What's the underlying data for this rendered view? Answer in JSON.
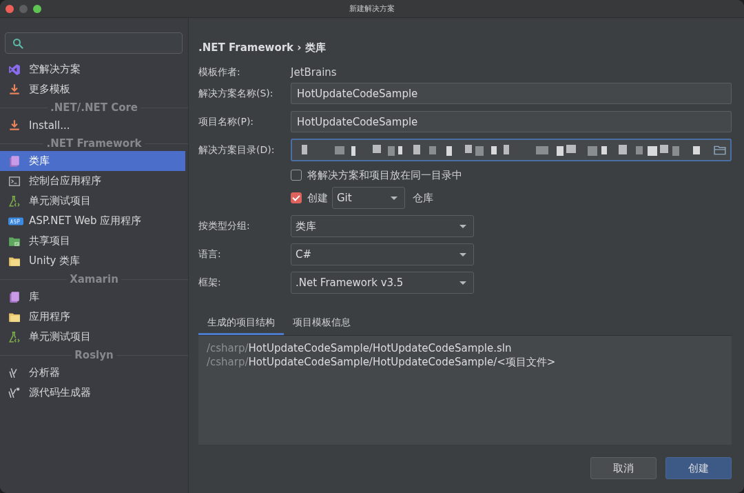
{
  "window": {
    "title": "新建解决方案"
  },
  "sidebar": {
    "items": [
      {
        "kind": "item",
        "label": "空解决方案",
        "selected": false
      },
      {
        "kind": "item",
        "label": "更多模板",
        "selected": false
      },
      {
        "kind": "header",
        "label": ".NET/.NET Core"
      },
      {
        "kind": "item",
        "label": "Install...",
        "selected": false
      },
      {
        "kind": "header",
        "label": ".NET Framework"
      },
      {
        "kind": "item",
        "label": "类库",
        "selected": true
      },
      {
        "kind": "item",
        "label": "控制台应用程序",
        "selected": false
      },
      {
        "kind": "item",
        "label": "单元测试项目",
        "selected": false
      },
      {
        "kind": "item",
        "label": "ASP.NET Web 应用程序",
        "selected": false
      },
      {
        "kind": "item",
        "label": "共享项目",
        "selected": false
      },
      {
        "kind": "item",
        "label": "Unity 类库",
        "selected": false
      },
      {
        "kind": "header",
        "label": "Xamarin"
      },
      {
        "kind": "item",
        "label": "库",
        "selected": false
      },
      {
        "kind": "item",
        "label": "应用程序",
        "selected": false
      },
      {
        "kind": "item",
        "label": "单元测试项目",
        "selected": false
      },
      {
        "kind": "header",
        "label": "Roslyn"
      },
      {
        "kind": "item",
        "label": "分析器",
        "selected": false
      },
      {
        "kind": "item",
        "label": "源代码生成器",
        "selected": false
      }
    ]
  },
  "breadcrumb": ".NET Framework › 类库",
  "form": {
    "author": {
      "label": "模板作者:",
      "value": "JetBrains"
    },
    "solution_name": {
      "label": "解决方案名称(S):",
      "value": "HotUpdateCodeSample"
    },
    "project_name": {
      "label": "项目名称(P):",
      "value": "HotUpdateCodeSample"
    },
    "solution_dir": {
      "label": "解决方案目录(D):",
      "focused": true
    },
    "same_dir": {
      "label": "将解决方案和项目放在同一目录中",
      "checked": false
    },
    "create_repo": {
      "label": "创建",
      "checked": true,
      "vcs": "Git",
      "suffix": "仓库"
    },
    "group_by": {
      "label": "按类型分组:",
      "value": "类库"
    },
    "language": {
      "label": "语言:",
      "value": "C#"
    },
    "framework": {
      "label": "框架:",
      "value": ".Net Framework v3.5"
    }
  },
  "tabs": [
    {
      "label": "生成的项目结构",
      "selected": true
    },
    {
      "label": "项目模板信息",
      "selected": false
    }
  ],
  "structure": [
    {
      "prefix": "/csharp/",
      "path": "HotUpdateCodeSample/HotUpdateCodeSample.sln"
    },
    {
      "prefix": "/csharp/",
      "path": "HotUpdateCodeSample/HotUpdateCodeSample/<项目文件>"
    }
  ],
  "buttons": [
    {
      "label": "取消",
      "kind": "secondary"
    },
    {
      "label": "创建",
      "kind": "primary"
    }
  ]
}
